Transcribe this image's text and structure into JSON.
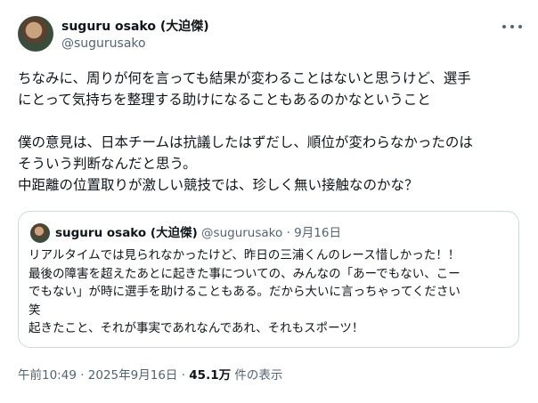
{
  "author": {
    "name": "suguru osako (大迫傑)",
    "handle": "@sugurusako"
  },
  "more_icon": "more-horizontal-icon",
  "tweet": {
    "lines": [
      "ちなみに、周りが何を言っても結果が変わることはないと思うけど、選手",
      "にとって気持ちを整理する助けになることもあるのかなということ",
      "",
      "僕の意見は、日本チームは抗議したはずだし、順位が変わらなかったのは",
      "そういう判断なんだと思う。",
      "中距離の位置取りが激しい競技では、珍しく無い接触なのかな？"
    ]
  },
  "quote": {
    "name": "suguru osako (大迫傑)",
    "handle": "@sugurusako",
    "separator": "·",
    "date": "9月16日",
    "lines": [
      "リアルタイムでは見られなかったけど、昨日の三浦くんのレース惜しかった！！",
      "最後の障害を超えたあとに起きた事についての、みんなの「あーでもない、こー",
      "でもない」が時に選手を助けることもある。だから大いに言っちゃってください",
      "笑",
      "起きたこと、それが事実であれなんであれ、それもスポーツ！"
    ]
  },
  "meta": {
    "timestamp": "午前10:49 · 2025年9月16日 · ",
    "views": "45.1万",
    "views_label": " 件の表示"
  },
  "colors": {
    "text": "#0f1419",
    "secondary": "#536471",
    "border": "#cfd9de"
  }
}
